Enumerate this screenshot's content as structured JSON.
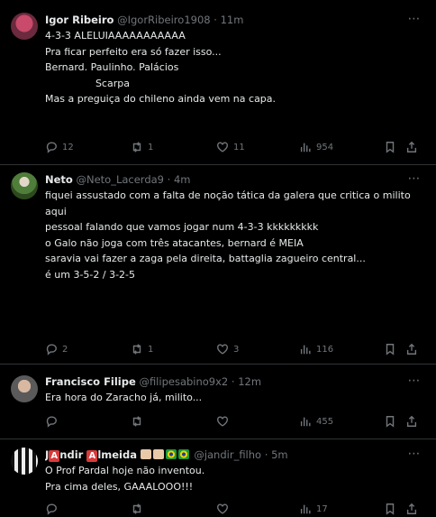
{
  "tweets": [
    {
      "name": "Igor Ribeiro",
      "handle": "@IgorRibeiro1908",
      "time": "11m",
      "lines": [
        "4-3-3 ALELUIAAAAAAAAAAA",
        "Pra ficar perfeito era só fazer isso...",
        "",
        "Bernard. Paulinho. Palácios",
        "                Scarpa",
        "",
        "Mas a preguiça do chileno ainda vem na capa."
      ],
      "replies": "12",
      "reposts": "1",
      "likes": "11",
      "views": "954"
    },
    {
      "name": "Neto",
      "handle": "@Neto_Lacerda9",
      "time": "4m",
      "lines": [
        "fiquei assustado com a falta de noção tática da galera que critica o milito",
        "aqui",
        "",
        "pessoal falando que vamos jogar num 4-3-3 kkkkkkkkk",
        "",
        "o Galo não joga com três atacantes, bernard é MEIA",
        "",
        "saravia vai fazer a zaga pela direita, battaglia zagueiro central...",
        "",
        "é um 3-5-2 / 3-2-5"
      ],
      "replies": "2",
      "reposts": "1",
      "likes": "3",
      "views": "116"
    },
    {
      "name": "Francisco Filipe",
      "handle": "@filipesabino9x2",
      "time": "12m",
      "lines": [
        "Era hora do Zaracho já, milito..."
      ],
      "replies": "",
      "reposts": "",
      "likes": "",
      "views": "455"
    },
    {
      "name_first": "J",
      "name_mid": "ndir ",
      "name_second": "A",
      "name_rest": "lmeida",
      "name_box_1": "A",
      "handle": "@jandir_filho",
      "time": "5m",
      "lines": [
        "O Prof Pardal hoje não inventou.",
        "Pra cima deles, GAAALOOO!!!"
      ],
      "replies": "",
      "reposts": "",
      "likes": "",
      "views": "17"
    }
  ],
  "separator": "·",
  "more_icon": "⋯",
  "colors": {
    "background": "#000000",
    "text": "#e7e9ea",
    "muted": "#71767b",
    "border": "#2f3336"
  }
}
